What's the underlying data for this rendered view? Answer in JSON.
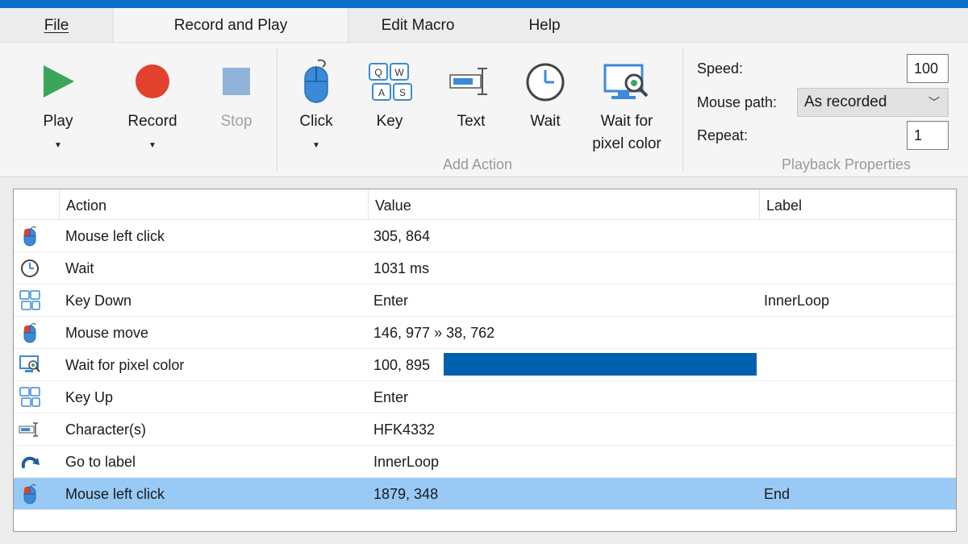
{
  "menu": {
    "file": "File",
    "record_and_play": "Record and Play",
    "edit_macro": "Edit Macro",
    "help": "Help"
  },
  "ribbon": {
    "play": "Play",
    "record": "Record",
    "stop": "Stop",
    "click": "Click",
    "key": "Key",
    "text": "Text",
    "wait": "Wait",
    "wait_pixel_line1": "Wait for",
    "wait_pixel_line2": "pixel color",
    "add_action_group": "Add Action",
    "playback_group": "Playback Properties",
    "keycaps": [
      "Q",
      "W",
      "A",
      "S"
    ]
  },
  "playback": {
    "speed_label": "Speed:",
    "speed_value": "100",
    "mouse_path_label": "Mouse path:",
    "mouse_path_value": "As recorded",
    "repeat_label": "Repeat:",
    "repeat_value": "1"
  },
  "table": {
    "headers": {
      "action": "Action",
      "value": "Value",
      "label": "Label"
    },
    "rows": [
      {
        "icon": "mouse-icon",
        "action": "Mouse left click",
        "value": "305, 864",
        "label": ""
      },
      {
        "icon": "clock-icon",
        "action": "Wait",
        "value": "1031 ms",
        "label": ""
      },
      {
        "icon": "keyboard-icon",
        "action": "Key Down",
        "value": "Enter",
        "label": "InnerLoop"
      },
      {
        "icon": "mouse-icon",
        "action": "Mouse move",
        "value": "146, 977 » 38, 762",
        "label": ""
      },
      {
        "icon": "pixel-monitor-icon",
        "action": "Wait for pixel color",
        "value": "100, 895",
        "label": "",
        "swatch_color": "#0060b0"
      },
      {
        "icon": "keyboard-icon",
        "action": "Key Up",
        "value": "Enter",
        "label": ""
      },
      {
        "icon": "text-cursor-icon",
        "action": "Character(s)",
        "value": "HFK4332",
        "label": ""
      },
      {
        "icon": "goto-arrow-icon",
        "action": "Go to label",
        "value": "InnerLoop",
        "label": ""
      },
      {
        "icon": "mouse-icon",
        "action": "Mouse left click",
        "value": "1879, 348",
        "label": "End",
        "selected": true
      }
    ]
  },
  "colors": {
    "accent": "#0a6fc9",
    "play_green": "#3aa65a",
    "record_red": "#e2412d",
    "stop_blue": "#8fb3d9",
    "selection": "#99c9f5"
  }
}
